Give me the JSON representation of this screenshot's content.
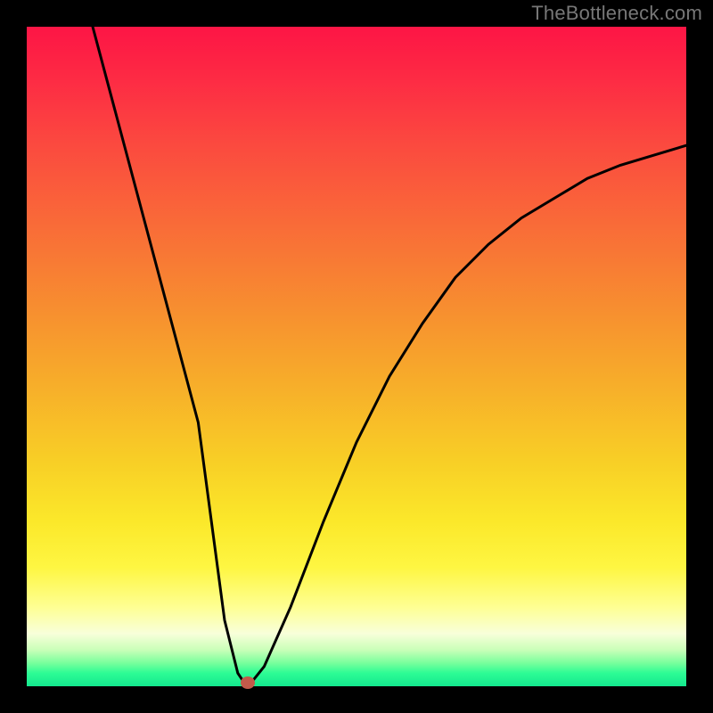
{
  "watermark": "TheBottleneck.com",
  "chart_data": {
    "type": "line",
    "title": "",
    "xlabel": "",
    "ylabel": "",
    "xlim": [
      0,
      100
    ],
    "ylim": [
      0,
      100
    ],
    "series": [
      {
        "name": "curve",
        "x": [
          10,
          14,
          18,
          22,
          26,
          28,
          30,
          32,
          33,
          34,
          36,
          40,
          45,
          50,
          55,
          60,
          65,
          70,
          75,
          80,
          85,
          90,
          95,
          100
        ],
        "y": [
          100,
          85,
          70,
          55,
          40,
          25,
          10,
          2,
          0.5,
          0.5,
          3,
          12,
          25,
          37,
          47,
          55,
          62,
          67,
          71,
          74,
          77,
          79,
          80.5,
          82
        ]
      }
    ],
    "marker": {
      "x": 33.5,
      "y": 0.5
    },
    "colors": {
      "curve": "#000000",
      "marker": "#c35a4a",
      "gradient_top": "#fd1545",
      "gradient_bottom": "#14e88e",
      "frame": "#000000"
    }
  }
}
